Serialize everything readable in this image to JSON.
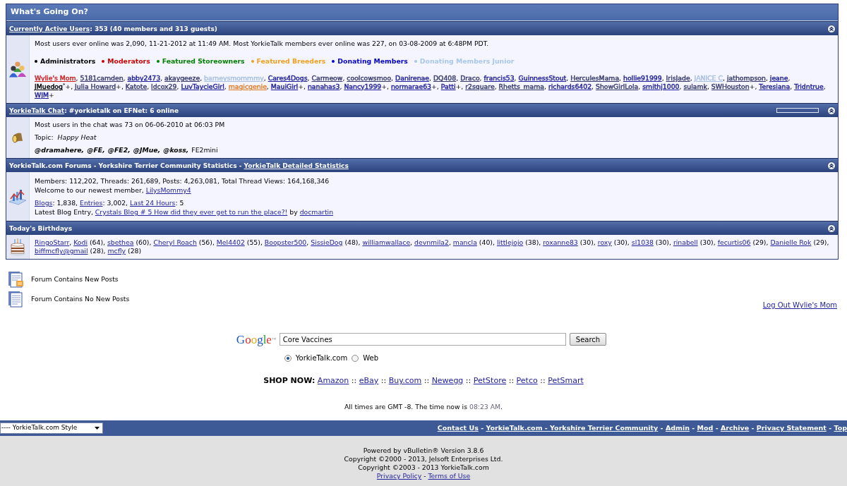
{
  "title": "What's Going On?",
  "active_users": {
    "header": [
      {
        "text": "Currently Active Users",
        "kind": "link"
      },
      {
        "text": ": 353 (40 members and 313 guests)",
        "kind": "text"
      }
    ],
    "record": "Most users ever online was 2,090, 11-21-2012 at 11:49 AM. Most YorkieTalk members ever online was 227, on 03-08-2009 at 6:48PM PDT.",
    "legend": [
      {
        "label": "Administrators",
        "color": "#000000"
      },
      {
        "label": "Moderators",
        "color": "#cc0000"
      },
      {
        "label": "Featured Storeowners",
        "color": "#008000"
      },
      {
        "label": "Featured Breeders",
        "color": "#f0a020"
      },
      {
        "label": "Donating Members",
        "color": "#0000cc"
      },
      {
        "label": "Donating Members Junior",
        "color": "#a8c8e8"
      }
    ],
    "separator": ",",
    "users": [
      {
        "name": "Wylie's Mom",
        "color": "#cc2222"
      },
      {
        "name": "5181camden",
        "color": "#383c6c"
      },
      {
        "name": "abby2473",
        "color": "#22229c"
      },
      {
        "name": "akaygeeze",
        "color": "#383c6c"
      },
      {
        "name": "barneysmommmy",
        "color": "#a8c0e0"
      },
      {
        "name": "Cares4Dogs",
        "color": "#22229c"
      },
      {
        "name": "Carmeow",
        "color": "#383c6c"
      },
      {
        "name": "coolcowsmoo",
        "color": "#383c6c"
      },
      {
        "name": "Danirenae",
        "color": "#22229c"
      },
      {
        "name": "DQ408",
        "color": "#383c6c"
      },
      {
        "name": "Draco",
        "color": "#383c6c"
      },
      {
        "name": "francis53",
        "color": "#22229c"
      },
      {
        "name": "GuinnessStout",
        "color": "#22229c"
      },
      {
        "name": "HerculesMama",
        "color": "#383c6c"
      },
      {
        "name": "hollie91999",
        "color": "#22229c"
      },
      {
        "name": "IrisJade",
        "color": "#383c6c"
      },
      {
        "name": "JANICE C",
        "color": "#a8c0e0"
      },
      {
        "name": "jathompson",
        "color": "#383c6c"
      },
      {
        "name": "jeane",
        "color": "#22229c"
      },
      {
        "name": "JMuedog",
        "color": "#000000",
        "suffix": "$^{*}$+"
      },
      {
        "name": "Julia Howard",
        "color": "#383c6c",
        "suffix": "+"
      },
      {
        "name": "Katote",
        "color": "#383c6c"
      },
      {
        "name": "ldcox29",
        "color": "#383c6c"
      },
      {
        "name": "LuvTaycieGirl",
        "color": "#22229c"
      },
      {
        "name": "magicgenie",
        "color": "#e0802c"
      },
      {
        "name": "MauiGirl",
        "color": "#22229c",
        "suffix": "+"
      },
      {
        "name": "nanahas3",
        "color": "#22229c"
      },
      {
        "name": "Nancy1999",
        "color": "#22229c",
        "suffix": "+"
      },
      {
        "name": "normarae63",
        "color": "#22229c",
        "suffix": "+"
      },
      {
        "name": "Patti",
        "color": "#22229c",
        "suffix": "+"
      },
      {
        "name": "r2square",
        "color": "#383c6c"
      },
      {
        "name": "Rhetts_mama",
        "color": "#383c6c"
      },
      {
        "name": "richards6402",
        "color": "#22229c"
      },
      {
        "name": "ShowGirlLola",
        "color": "#383c6c"
      },
      {
        "name": "smithj1000",
        "color": "#22229c"
      },
      {
        "name": "sulamk",
        "color": "#383c6c"
      },
      {
        "name": "SWHouston",
        "color": "#383c6c",
        "suffix": "+"
      },
      {
        "name": "Teresiana",
        "color": "#22229c"
      },
      {
        "name": "Tridntrue",
        "color": "#22229c"
      },
      {
        "name": "WJM",
        "color": "#22229c",
        "suffix": "+"
      }
    ]
  },
  "chat": {
    "header": [
      {
        "text": "YorkieTalk Chat",
        "kind": "link"
      },
      {
        "text": ": #yorkietalk on EFNet: 6 online",
        "kind": "text"
      }
    ],
    "record": "Most users in the chat was 73 on 06-06-2010 at 06:03 PM",
    "topic": "Topic:  *Happy Heat*",
    "separator": ",",
    "users": [
      {
        "name": "@dramahere",
        "op": true
      },
      {
        "name": "@FE",
        "op": true
      },
      {
        "name": "@FE2",
        "op": true
      },
      {
        "name": "@JMue",
        "op": true
      },
      {
        "name": "@koss",
        "op": true
      },
      {
        "name": "FE2mini",
        "op": false
      }
    ]
  },
  "statistics": {
    "header": [
      {
        "text": "YorkieTalk.com Forums - Yorkshire Terrier Community Statistics - ",
        "kind": "text"
      },
      {
        "text": "YorkieTalk Detailed Statistics",
        "kind": "link"
      }
    ],
    "paragraphs": [
      [
        [
          {
            "text": "Members: 112,202, Threads: 261,689, Posts: 4,263,081, Total Thread Views: 164,168,346",
            "kind": "text"
          }
        ],
        [
          {
            "text": "Welcome to our newest member, ",
            "kind": "text"
          },
          {
            "text": "LilysMommy4",
            "kind": "link"
          }
        ]
      ],
      [
        [
          {
            "text": "Blogs",
            "kind": "link"
          },
          {
            "text": ": 1,838, ",
            "kind": "text"
          },
          {
            "text": "Entries",
            "kind": "link"
          },
          {
            "text": ": 3,002, ",
            "kind": "text"
          },
          {
            "text": "Last 24 Hours",
            "kind": "link"
          },
          {
            "text": ": 5",
            "kind": "text"
          }
        ],
        [
          {
            "text": "Latest Blog Entry, ",
            "kind": "text"
          },
          {
            "text": "Crystals Blog # 5 How did they ever get to run the place?!",
            "kind": "link"
          },
          {
            "text": " by ",
            "kind": "text"
          },
          {
            "text": "docmartin",
            "kind": "link"
          }
        ]
      ]
    ]
  },
  "birthdays": {
    "header": [
      {
        "text": "Today's Birthdays",
        "kind": "text"
      }
    ],
    "separator": ",",
    "people": [
      {
        "name": "RingoStarr"
      },
      {
        "name": "Kodi",
        "age": "(64)"
      },
      {
        "name": "sbethea",
        "age": "(60)"
      },
      {
        "name": "Cheryl Roach",
        "age": "(56)"
      },
      {
        "name": "Mel4402",
        "age": "(55)"
      },
      {
        "name": "Boopster500"
      },
      {
        "name": "SissieDog",
        "age": "(48)"
      },
      {
        "name": "williamwallace"
      },
      {
        "name": "devnmila2"
      },
      {
        "name": "mancla",
        "age": "(40)"
      },
      {
        "name": "littlejojo",
        "age": "(38)"
      },
      {
        "name": "roxanne83",
        "age": "(30)"
      },
      {
        "name": "roxy",
        "age": "(30)"
      },
      {
        "name": "sl1038",
        "age": "(30)"
      },
      {
        "name": "rinabell",
        "age": "(30)"
      },
      {
        "name": "fecurtis06",
        "age": "(29)"
      },
      {
        "name": "Danielle Rok",
        "age": "(29)"
      },
      {
        "name": "biffmcfly@gmail",
        "age": "(28)"
      },
      {
        "name": "mcfly",
        "age": "(28)"
      }
    ]
  },
  "forum_legend": [
    {
      "label": "Forum Contains New Posts",
      "kind": "new"
    },
    {
      "label": "Forum Contains No New Posts",
      "kind": "old"
    }
  ],
  "logout": "Log Out Wylie's Mom",
  "search": {
    "logo": "Google™",
    "value": "Core Vaccines",
    "button": "Search",
    "options": [
      {
        "label": "YorkieTalk.com",
        "selected": true
      },
      {
        "label": "Web",
        "selected": false
      }
    ]
  },
  "shop": {
    "label": "SHOP NOW:",
    "separator": "::",
    "links": [
      "Amazon",
      "eBay",
      "Buy.com",
      "Newegg",
      "PetStore",
      "Petco",
      "PetSmart"
    ]
  },
  "time": {
    "prefix": "All times are GMT -8. The time now is",
    "time": "08:23 AM",
    "suffix": "."
  },
  "footer": {
    "style_select": "---- YorkieTalk.com Style",
    "separator": "-",
    "links": [
      "Contact Us",
      "YorkieTalk.com - Yorkshire Terrier Community",
      "Admin",
      "Mod",
      "Archive",
      "Privacy Statement",
      "Top"
    ]
  },
  "copyright": {
    "lines": [
      "Powered by vBulletin® Version 3.8.6",
      "Copyright ©2000 - 2013, Jelsoft Enterprises Ltd.",
      "Copyright ©2003 - 2013 YorkieTalk.com"
    ],
    "separator": "-",
    "links": [
      "Privacy Policy",
      "Terms of Use"
    ]
  }
}
